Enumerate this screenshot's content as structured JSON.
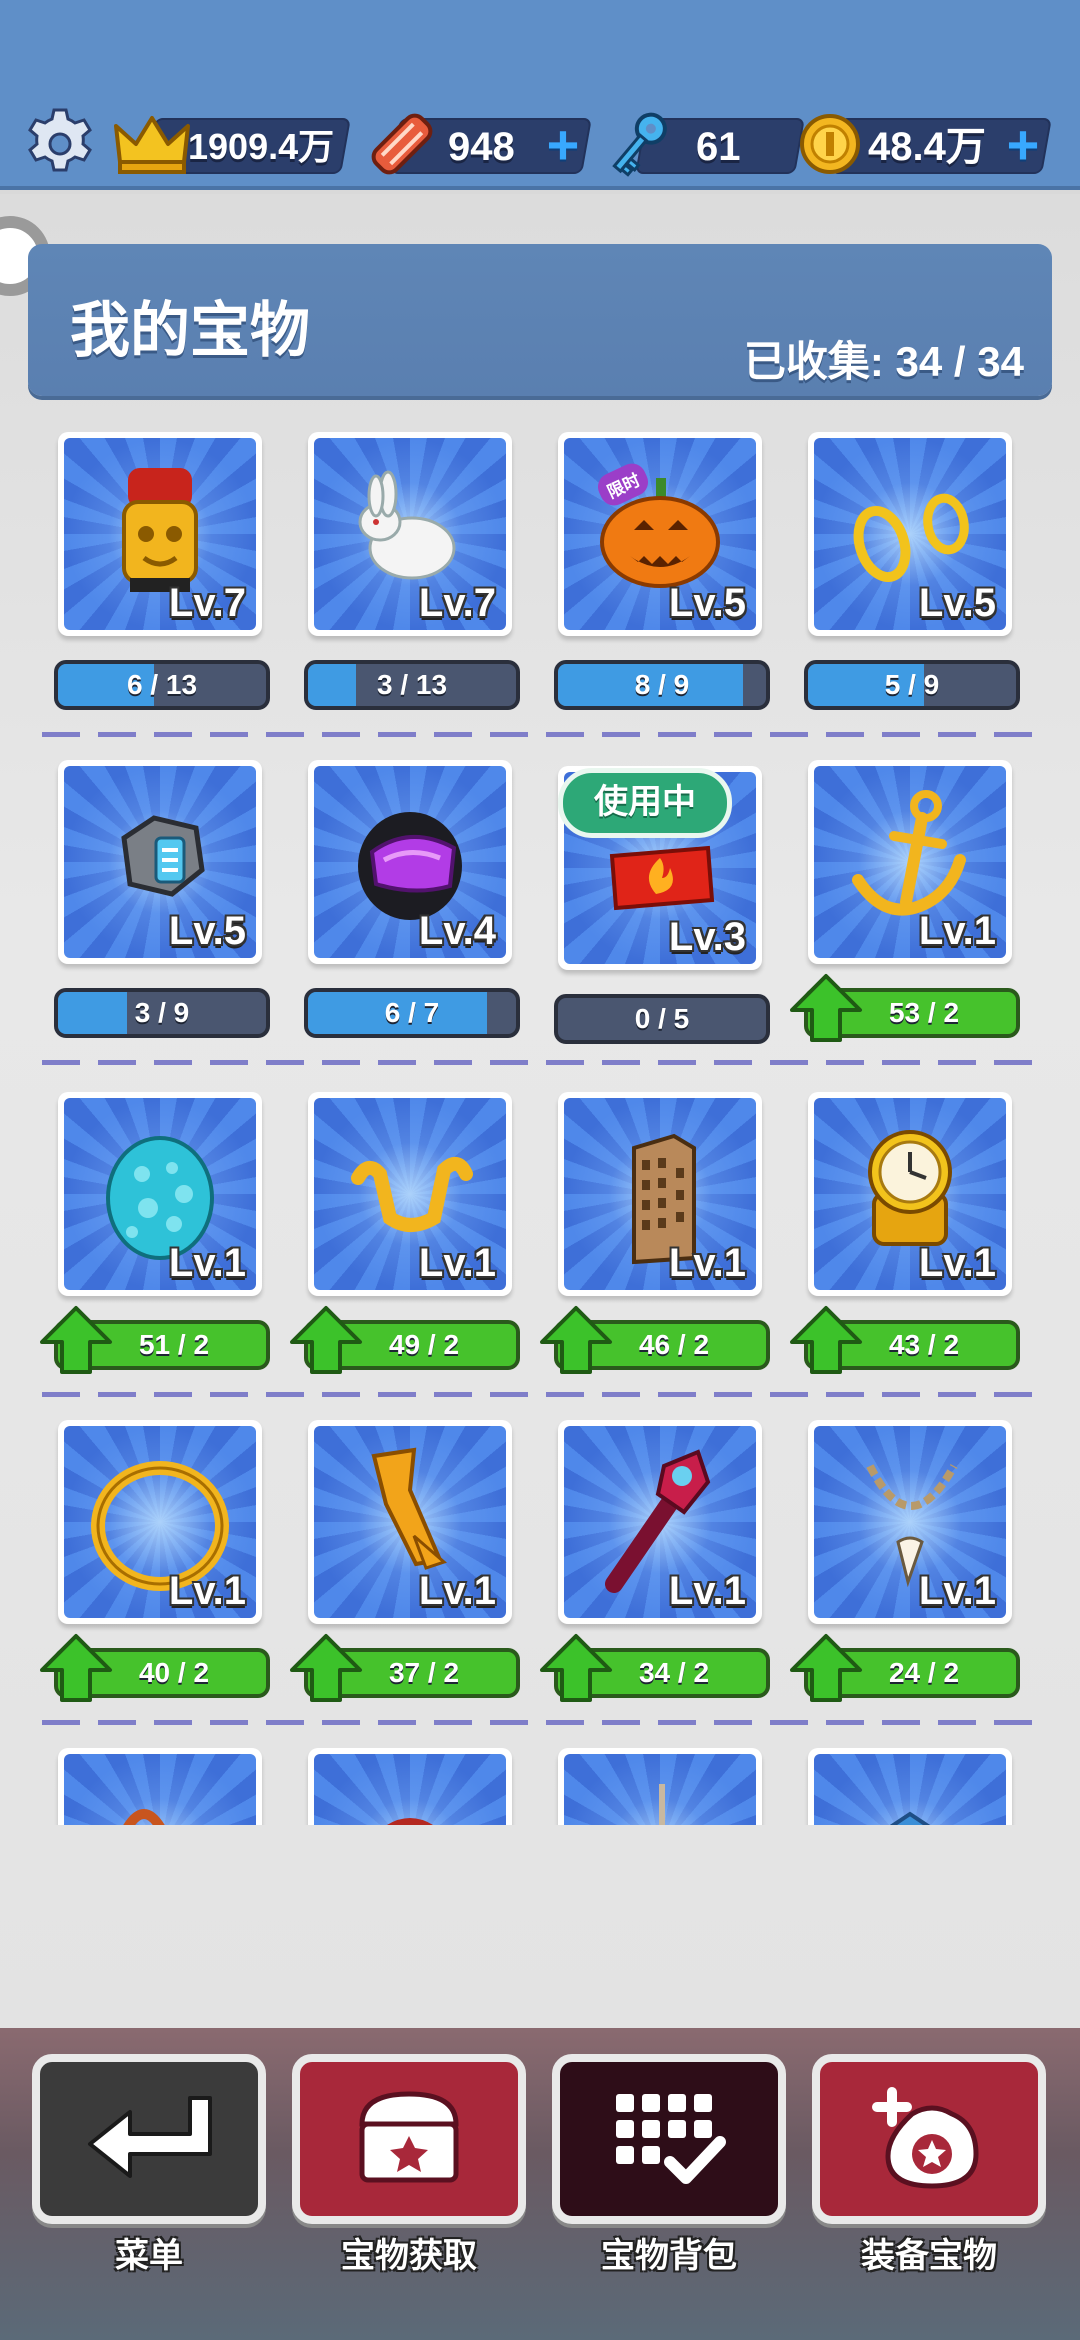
{
  "topbar": {
    "crown_score": "1909.4万",
    "tickets": "948",
    "keys": "61",
    "coins": "48.4万"
  },
  "header": {
    "title": "我的宝物",
    "collected_label": "已收集:",
    "collected": "34 / 34"
  },
  "inuse_label": "使用中",
  "limited_label": "限时",
  "items": [
    {
      "name": "golden-idol",
      "level": "Lv.7",
      "progress": "6 / 13",
      "fill": 0.46,
      "upgrade": false
    },
    {
      "name": "white-rabbit",
      "level": "Lv.7",
      "progress": "3 / 13",
      "fill": 0.23,
      "upgrade": false
    },
    {
      "name": "pumpkin",
      "level": "Lv.5",
      "progress": "8 / 9",
      "fill": 0.89,
      "upgrade": false
    },
    {
      "name": "gold-rings",
      "level": "Lv.5",
      "progress": "5 / 9",
      "fill": 0.56,
      "upgrade": false
    },
    {
      "name": "hex-ring",
      "level": "Lv.5",
      "progress": "3 / 9",
      "fill": 0.33,
      "upgrade": false
    },
    {
      "name": "helmet",
      "level": "Lv.4",
      "progress": "6 / 7",
      "fill": 0.86,
      "upgrade": false
    },
    {
      "name": "fire-box",
      "level": "Lv.3",
      "progress": "0 / 5",
      "fill": 0,
      "upgrade": false
    },
    {
      "name": "anchor",
      "level": "Lv.1",
      "progress": "53 / 2",
      "fill": 1,
      "upgrade": true
    },
    {
      "name": "spotted-egg",
      "level": "Lv.1",
      "progress": "51 / 2",
      "fill": 1,
      "upgrade": true
    },
    {
      "name": "gold-slingshot",
      "level": "Lv.1",
      "progress": "49 / 2",
      "fill": 1,
      "upgrade": true
    },
    {
      "name": "skyscraper",
      "level": "Lv.1",
      "progress": "46 / 2",
      "fill": 1,
      "upgrade": true
    },
    {
      "name": "gold-watch",
      "level": "Lv.1",
      "progress": "43 / 2",
      "fill": 1,
      "upgrade": true
    },
    {
      "name": "gold-hoop",
      "level": "Lv.1",
      "progress": "40 / 2",
      "fill": 1,
      "upgrade": true
    },
    {
      "name": "feather-blade",
      "level": "Lv.1",
      "progress": "37 / 2",
      "fill": 1,
      "upgrade": true
    },
    {
      "name": "magic-staff",
      "level": "Lv.1",
      "progress": "34 / 2",
      "fill": 1,
      "upgrade": true
    },
    {
      "name": "tooth-necklace",
      "level": "Lv.1",
      "progress": "24 / 2",
      "fill": 1,
      "upgrade": true
    }
  ],
  "nav": [
    {
      "label": "菜单",
      "icon": "return-arrow-icon",
      "color": "#3a3a3a"
    },
    {
      "label": "宝物获取",
      "icon": "treasure-chest-icon",
      "color": "#a8283a"
    },
    {
      "label": "宝物背包",
      "icon": "grid-check-icon",
      "color": "#2e0d18"
    },
    {
      "label": "装备宝物",
      "icon": "equip-treasure-icon",
      "color": "#a8283a"
    }
  ]
}
